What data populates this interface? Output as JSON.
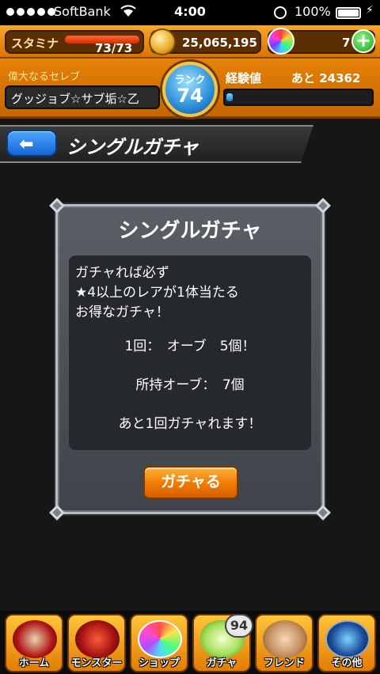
{
  "status_bar": {
    "carrier": "SoftBank",
    "time": "4:00",
    "battery": "100%"
  },
  "hud": {
    "stamina_label": "スタミナ",
    "stamina_value": "73/73",
    "stamina_fraction": 1.0,
    "gold": "25,065,195",
    "orbs": "7",
    "plus_label": "+",
    "player_title": "偉大なるセレブ",
    "player_name": "グッジョブ☆サブ垢☆乙",
    "rank_label": "ランク",
    "rank_value": "74",
    "exp_label": "経験値",
    "exp_remaining": "あと 24362",
    "exp_fraction": 0.04
  },
  "header": {
    "back_arrow": "⬅",
    "title": "シングルガチャ"
  },
  "panel": {
    "title": "シングルガチャ",
    "line1": "ガチャれば必ず",
    "line2": "★4以上のレアが1体当たる",
    "line3": "お得なガチャ！",
    "cost": "1回：　オーブ　5個！",
    "owned": "所持オーブ：　7個",
    "remaining": "あと1回ガチャれます！",
    "button": "ガチャる"
  },
  "nav": {
    "home": "ホーム",
    "monster": "モンスター",
    "shop": "ショップ",
    "gacha": "ガチャ",
    "gacha_badge": "94",
    "friend": "フレンド",
    "other": "その他"
  }
}
